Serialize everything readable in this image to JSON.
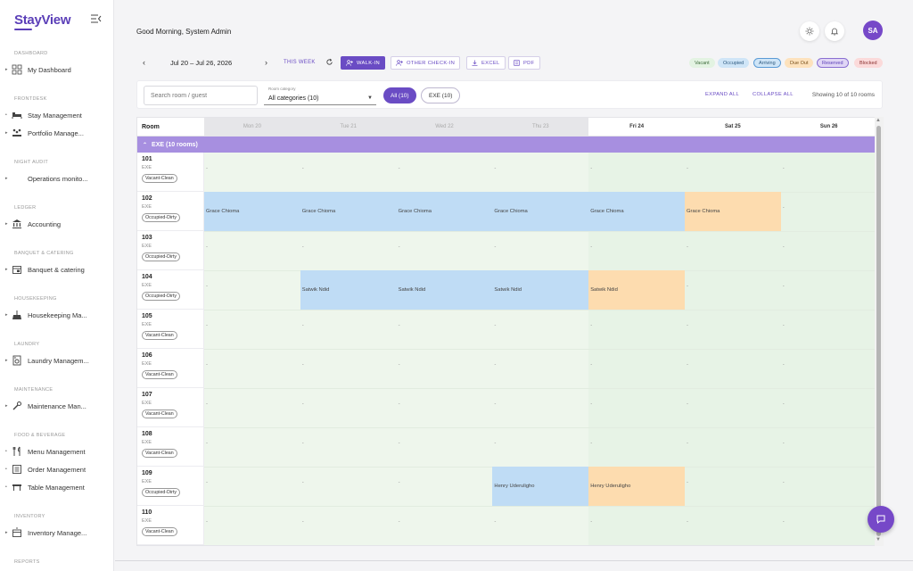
{
  "app": {
    "brand": "StayView"
  },
  "header": {
    "greeting": "Good Morning, System Admin",
    "avatar_initials": "SA"
  },
  "sidebar": {
    "sections": [
      {
        "label": "DASHBOARD",
        "items": [
          {
            "label": "My Dashboard",
            "icon": "dashboard-icon",
            "expandable": true
          }
        ]
      },
      {
        "label": "FRONTDESK",
        "items": [
          {
            "label": "Stay Management",
            "icon": "bed-icon",
            "expandable": false
          },
          {
            "label": "Portfolio Manage...",
            "icon": "people-icon",
            "expandable": true
          }
        ]
      },
      {
        "label": "NIGHT AUDIT",
        "items": [
          {
            "label": "Operations monito...",
            "icon": "moon-icon",
            "expandable": true
          }
        ]
      },
      {
        "label": "LEDGER",
        "items": [
          {
            "label": "Accounting",
            "icon": "bank-icon",
            "expandable": true
          }
        ]
      },
      {
        "label": "BANQUET & CATERING",
        "items": [
          {
            "label": "Banquet & catering",
            "icon": "calendar-icon",
            "expandable": true
          }
        ]
      },
      {
        "label": "HOUSEKEEPING",
        "items": [
          {
            "label": "Housekeeping Ma...",
            "icon": "broom-icon",
            "expandable": true
          }
        ]
      },
      {
        "label": "LAUNDRY",
        "items": [
          {
            "label": "Laundry Managem...",
            "icon": "washer-icon",
            "expandable": true
          }
        ]
      },
      {
        "label": "MAINTENANCE",
        "items": [
          {
            "label": "Maintenance Man...",
            "icon": "wrench-icon",
            "expandable": true
          }
        ]
      },
      {
        "label": "FOOD & BEVERAGE",
        "items": [
          {
            "label": "Menu Management",
            "icon": "cutlery-icon",
            "expandable": false
          },
          {
            "label": "Order Management",
            "icon": "list-icon",
            "expandable": false
          },
          {
            "label": "Table Management",
            "icon": "table-icon",
            "expandable": false
          }
        ]
      },
      {
        "label": "INVENTORY",
        "items": [
          {
            "label": "Inventory Manage...",
            "icon": "box-icon",
            "expandable": true
          }
        ]
      },
      {
        "label": "REPORTS",
        "items": []
      }
    ]
  },
  "toolbar": {
    "date_range": "Jul 20 – Jul 26, 2026",
    "this_week": "THIS WEEK",
    "walk_in": "WALK-IN",
    "other_check_in": "OTHER CHECK-IN",
    "excel": "EXCEL",
    "pdf": "PDF"
  },
  "legend": [
    {
      "label": "Vacant",
      "bg": "#e3f3e2",
      "fg": "#3d6b3b",
      "border": "#e3f3e2"
    },
    {
      "label": "Occupied",
      "bg": "#cfe5f7",
      "fg": "#2f5b80",
      "border": "#cfe5f7"
    },
    {
      "label": "Arriving",
      "bg": "#cfe5f7",
      "fg": "#2f5b80",
      "border": "#5b9bd5"
    },
    {
      "label": "Due Out",
      "bg": "#fde2bd",
      "fg": "#7a5320",
      "border": "#fde2bd"
    },
    {
      "label": "Reserved",
      "bg": "#e0d6f5",
      "fg": "#5b3fb8",
      "border": "#8a6fd1"
    },
    {
      "label": "Blocked",
      "bg": "#fbdada",
      "fg": "#8a3030",
      "border": "#fbdada"
    }
  ],
  "filters": {
    "search_placeholder": "Search room / guest",
    "category_label": "Room category",
    "category_value": "All categories (10)",
    "all_pill": "All (10)",
    "exe_pill": "EXE (10)",
    "expand_all": "EXPAND ALL",
    "collapse_all": "COLLAPSE ALL",
    "showing": "Showing 10 of 10 rooms"
  },
  "grid": {
    "room_header": "Room",
    "days": [
      {
        "label": "Mon 20",
        "past": true
      },
      {
        "label": "Tue 21",
        "past": true
      },
      {
        "label": "Wed 22",
        "past": true
      },
      {
        "label": "Thu 23",
        "past": true
      },
      {
        "label": "Fri 24",
        "past": false
      },
      {
        "label": "Sat 25",
        "past": false
      },
      {
        "label": "Sun 26",
        "past": false
      }
    ],
    "group_label": "EXE (10 rooms)",
    "rooms": [
      {
        "number": "101",
        "type": "EXE",
        "status": "Vacant-Clean",
        "bookings": []
      },
      {
        "number": "102",
        "type": "EXE",
        "status": "Occupied-Dirty",
        "bookings": [
          {
            "guest": "Grace Chioma",
            "day": 0,
            "color": "blue"
          },
          {
            "guest": "Grace Chioma",
            "day": 1,
            "color": "blue"
          },
          {
            "guest": "Grace Chioma",
            "day": 2,
            "color": "blue"
          },
          {
            "guest": "Grace Chioma",
            "day": 3,
            "color": "blue"
          },
          {
            "guest": "Grace Chioma",
            "day": 4,
            "color": "blue"
          },
          {
            "guest": "Grace Chioma",
            "day": 5,
            "color": "orange"
          }
        ]
      },
      {
        "number": "103",
        "type": "EXE",
        "status": "Occupied-Dirty",
        "bookings": []
      },
      {
        "number": "104",
        "type": "EXE",
        "status": "Occupied-Dirty",
        "bookings": [
          {
            "guest": "Satwik Ndid",
            "day": 1,
            "color": "blue"
          },
          {
            "guest": "Satwik Ndid",
            "day": 2,
            "color": "blue"
          },
          {
            "guest": "Satwik Ndid",
            "day": 3,
            "color": "blue"
          },
          {
            "guest": "Satwik Ndid",
            "day": 4,
            "color": "orange"
          }
        ]
      },
      {
        "number": "105",
        "type": "EXE",
        "status": "Vacant-Clean",
        "bookings": []
      },
      {
        "number": "106",
        "type": "EXE",
        "status": "Vacant-Clean",
        "bookings": []
      },
      {
        "number": "107",
        "type": "EXE",
        "status": "Vacant-Clean",
        "bookings": []
      },
      {
        "number": "108",
        "type": "EXE",
        "status": "Vacant-Clean",
        "bookings": []
      },
      {
        "number": "109",
        "type": "EXE",
        "status": "Occupied-Dirty",
        "bookings": [
          {
            "guest": "Henry Uderuligho",
            "day": 3,
            "color": "blue"
          },
          {
            "guest": "Henry Uderuligho",
            "day": 4,
            "color": "orange"
          }
        ]
      },
      {
        "number": "110",
        "type": "EXE",
        "status": "Vacant-Clean",
        "bookings": []
      }
    ]
  }
}
